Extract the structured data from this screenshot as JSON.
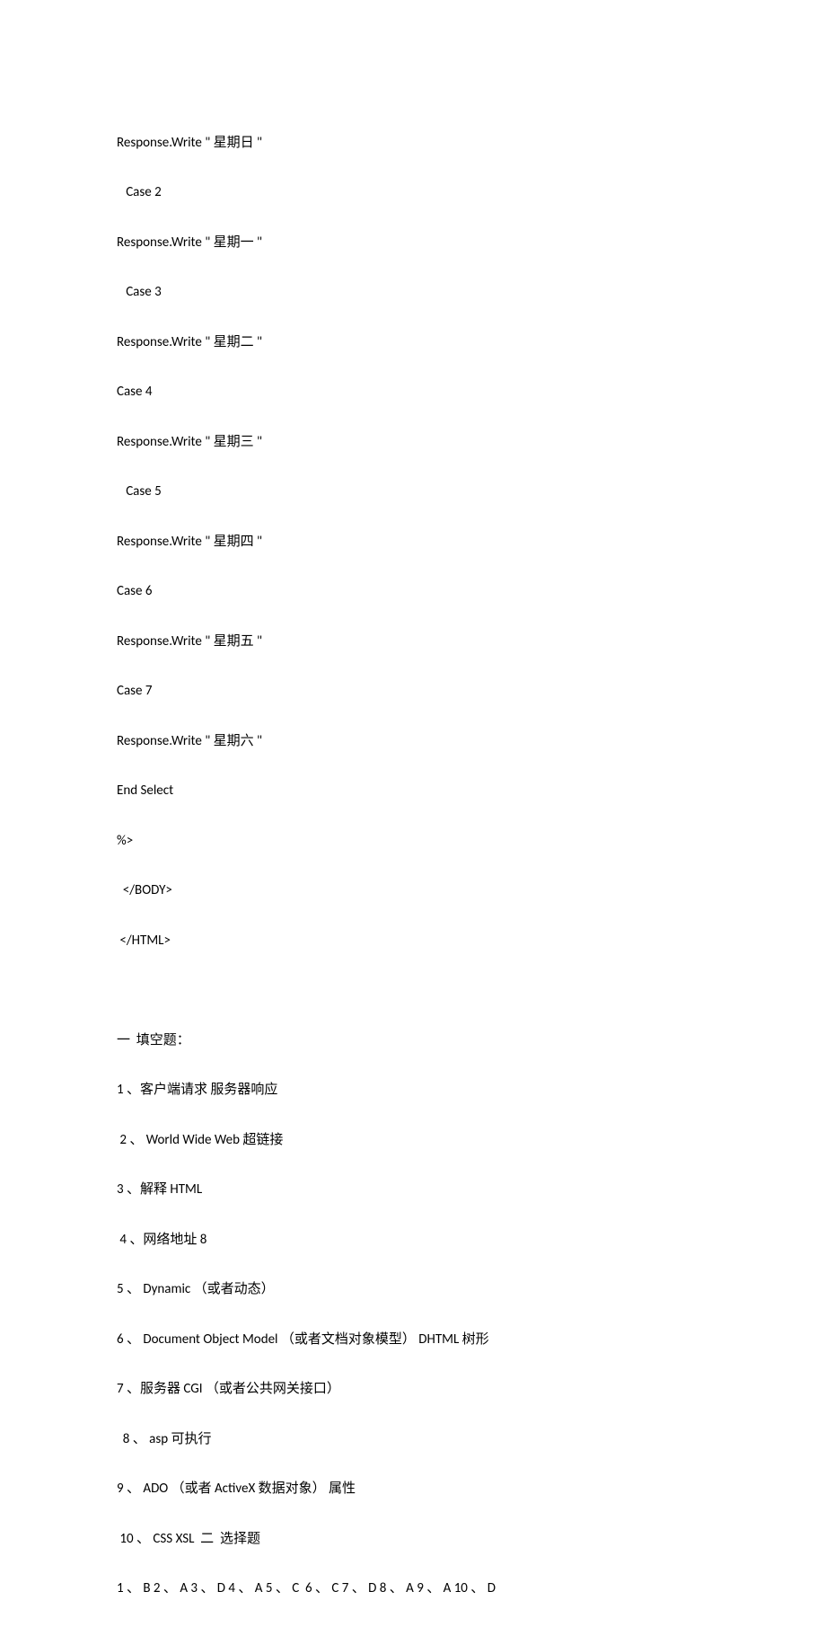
{
  "code_lines": [
    "Response.Write \" 星期日 \"",
    "   Case 2",
    "Response.Write \" 星期一 \"",
    "   Case 3",
    "Response.Write \" 星期二 \"",
    "Case 4",
    "Response.Write \" 星期三 \"",
    "   Case 5",
    "Response.Write \" 星期四 \"",
    "Case 6",
    "Response.Write \" 星期五 \"",
    "Case 7",
    "Response.Write \" 星期六 \"",
    "End Select",
    "%>",
    "  </BODY>",
    " </HTML>"
  ],
  "blank_line": " ",
  "answer_lines": [
    "一  填空题：",
    "1 、客户端请求 服务器响应",
    " 2 、 World Wide Web 超链接",
    "3 、解释 HTML",
    " 4 、网络地址 8",
    "5 、 Dynamic （或者动态）",
    "6 、 Document Object Model （或者文档对象模型） DHTML 树形",
    "7 、服务器 CGI （或者公共网关接口）",
    "  8 、 asp 可执行",
    "9 、 ADO （或者 ActiveX 数据对象） 属性",
    " 10 、 CSS XSL  二  选择题",
    "1 、 B 2 、 A 3 、 D 4 、 A 5 、 C  6 、 C 7 、 D 8 、 A 9 、 A 10 、 D"
  ]
}
